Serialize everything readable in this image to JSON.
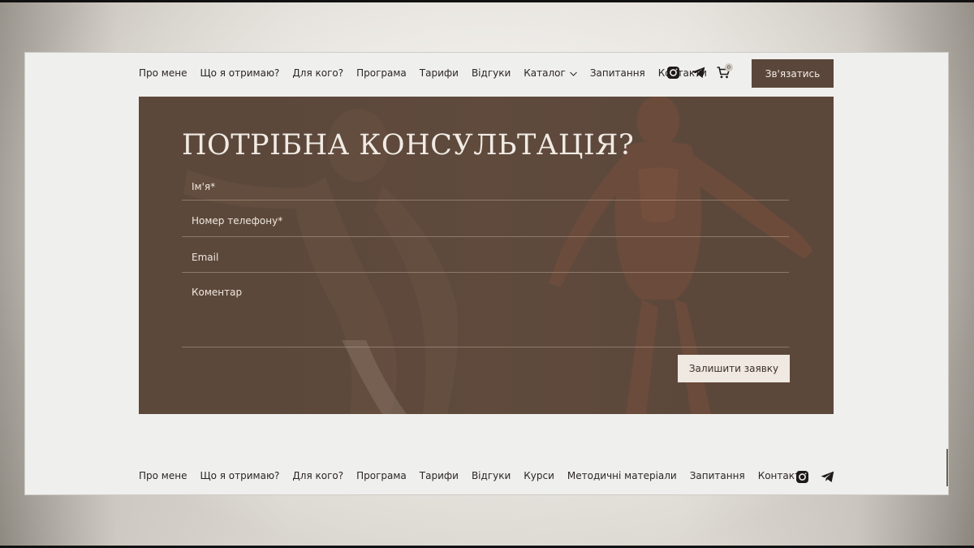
{
  "header": {
    "nav": [
      {
        "label": "Про мене"
      },
      {
        "label": "Що я отримаю?"
      },
      {
        "label": "Для кого?"
      },
      {
        "label": "Програма"
      },
      {
        "label": "Тарифи"
      },
      {
        "label": "Відгуки"
      },
      {
        "label": "Каталог"
      },
      {
        "label": "Запитання"
      },
      {
        "label": "Контакти"
      }
    ],
    "icons": [
      "instagram-icon",
      "telegram-icon",
      "cart-icon"
    ],
    "cart_count": "0",
    "contact_button": "Зв'язатись"
  },
  "form": {
    "title": "ПОТРІБНА КОНСУЛЬТАЦІЯ?",
    "fields": [
      {
        "label": "Ім'я*"
      },
      {
        "label": "Номер телефону*"
      },
      {
        "label": "Email"
      },
      {
        "label": "Коментар"
      }
    ],
    "submit_label": "Залишити заявку"
  },
  "footer": {
    "nav": [
      {
        "label": "Про мене"
      },
      {
        "label": "Що я отримаю?"
      },
      {
        "label": "Для кого?"
      },
      {
        "label": "Програма"
      },
      {
        "label": "Тарифи"
      },
      {
        "label": "Відгуки"
      },
      {
        "label": "Курси"
      },
      {
        "label": "Методичні матеріали"
      },
      {
        "label": "Запитання"
      },
      {
        "label": "Контакти"
      }
    ],
    "icons": [
      "instagram-icon",
      "telegram-icon"
    ]
  },
  "colors": {
    "page_bg": "#efefed",
    "panel_bg": "#5c483b",
    "button_dark": "#5a463a",
    "button_light": "#efe9e2",
    "text_dark": "#2b2623"
  }
}
